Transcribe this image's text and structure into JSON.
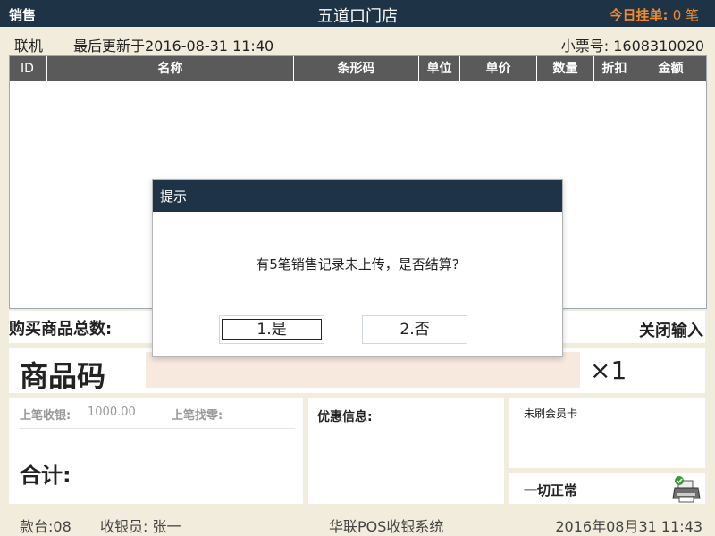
{
  "topbar": {
    "mode": "销售",
    "store": "五道口门店",
    "held_label": "今日挂单:",
    "held_count": "0 笔"
  },
  "status": {
    "online": "联机",
    "last_update": "最后更新于2016-08-31  11:40",
    "ticket_label": "小票号:",
    "ticket_no": "1608310020"
  },
  "table": {
    "columns": [
      "ID",
      "名称",
      "条形码",
      "单位",
      "单价",
      "数量",
      "折扣",
      "金额"
    ],
    "rows": []
  },
  "total_items_label": "购买商品总数:",
  "close_input_label": "关闭输入",
  "barcode": {
    "label": "商品码",
    "value": "",
    "qty": "×1"
  },
  "payment": {
    "last_received_label": "上笔收银:",
    "last_received_value": "1000.00",
    "last_change_label": "上笔找零:",
    "sum_label": "合计:"
  },
  "promo": {
    "label": "优惠信息:"
  },
  "member": {
    "label": "未刷会员卡"
  },
  "device": {
    "label": "一切正常",
    "icon": "printer-ok-icon"
  },
  "footer": {
    "station": "款台:08",
    "cashier": "收银员: 张一",
    "system": "华联POS收银系统",
    "datetime": "2016年08月31   11:43"
  },
  "dialog": {
    "title": "提示",
    "message": "有5笔销售记录未上传，是否结算?",
    "yes_label": "1.是",
    "no_label": "2.否"
  },
  "colors": {
    "header_bg": "#1e3346",
    "accent_orange": "#f28a2e",
    "input_bg": "#f8e9df",
    "page_bg": "#f1ecdc"
  }
}
